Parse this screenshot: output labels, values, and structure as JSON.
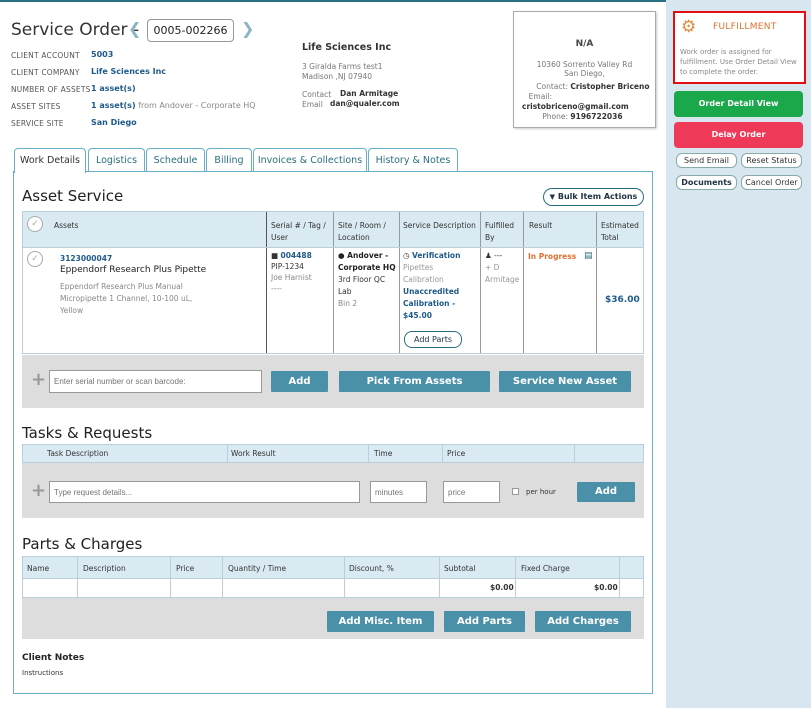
{
  "header": {
    "title": "Service Order -",
    "order_number": "0005-002266",
    "fields": [
      {
        "label": "CLIENT ACCOUNT",
        "value": "5003",
        "extra": ""
      },
      {
        "label": "CLIENT COMPANY",
        "value": "Life Sciences Inc",
        "extra": ""
      },
      {
        "label": "NUMBER OF ASSETS",
        "value": "1 asset(s)",
        "extra": ""
      },
      {
        "label": "ASSET SITES",
        "value": "1 asset(s)",
        "extra": " from Andover - Corporate HQ"
      },
      {
        "label": "SERVICE SITE",
        "value": "San Diego",
        "extra": ""
      }
    ],
    "company": {
      "name": "Life Sciences Inc",
      "address1": "3 Giralda Farms test1",
      "address2": "Madison ,NJ 07940",
      "contact_label": "Contact",
      "contact": "Dan Armitage",
      "email_label": "Email",
      "email": "dan@qualer.com"
    },
    "card": {
      "title": "N/A",
      "address1": "10360 Sorrento Valley Rd",
      "address2": "San Diego,",
      "contact_label": "Contact:",
      "contact": "Cristopher Briceno",
      "email_label": "Email:",
      "email": "cristobriceno@gmail.com",
      "phone_label": "Phone:",
      "phone": "9196722036"
    }
  },
  "sidebar": {
    "fulfillment_title": "FULFILLMENT",
    "fulfillment_text": "Work order is assigned for fulfillment. Use Order Detail View to complete the order.",
    "order_detail_view": "Order Detail View",
    "delay_order": "Delay Order",
    "send_email": "Send Email",
    "reset_status": "Reset Status",
    "documents": "Documents",
    "cancel_order": "Cancel Order"
  },
  "tabs": [
    "Work Details",
    "Logistics",
    "Schedule",
    "Billing",
    "Invoices & Collections",
    "History & Notes"
  ],
  "asset_service": {
    "title": "Asset Service",
    "bulk_actions": "Bulk Item Actions",
    "columns": [
      "Assets",
      "Serial # / Tag / User",
      "Site / Room / Location",
      "Service Description",
      "Fulfilled By",
      "Result",
      "Estimated Total"
    ],
    "row": {
      "asset_id": "3123000047",
      "asset_name": "Eppendorf Research Plus Pipette",
      "asset_desc1": "Eppendorf Research Plus Manual",
      "asset_desc2": "Micropipette 1 Channel, 10-100 uL,",
      "asset_desc3": "Yellow",
      "serial": "004488",
      "tag": "PIP-1234",
      "user": "Joe Harnist",
      "user_extra": "----",
      "site": "Andover -",
      "site2": "Corporate HQ",
      "room": "3rd Floor QC",
      "room2": "Lab",
      "location": "Bin 2",
      "service": "Verification",
      "service_sub1": "Pipettes",
      "service_sub2": "Calibration",
      "service_un1": "Unaccredited",
      "service_un2": "Calibration -",
      "service_price": "$45.00",
      "add_parts": "Add Parts",
      "fulfilled": "---",
      "fulfilled_by1": "+ D",
      "fulfilled_by2": "Armitage",
      "result": "In Progress",
      "total": "$36.00"
    },
    "serial_placeholder": "Enter serial number or scan barcode:",
    "add": "Add",
    "pick_from_assets": "Pick From Assets",
    "service_new_asset": "Service New Asset"
  },
  "tasks": {
    "title": "Tasks & Requests",
    "columns": [
      "Task Description",
      "Work Result",
      "Time",
      "Price"
    ],
    "request_placeholder": "Type request details...",
    "minutes_placeholder": "minutes",
    "price_placeholder": "price",
    "per_hour": "per hour",
    "add": "Add"
  },
  "parts": {
    "title": "Parts & Charges",
    "columns": [
      "Name",
      "Description",
      "Price",
      "Quantity / Time",
      "Discount, %",
      "Subtotal",
      "Fixed Charge"
    ],
    "subtotal": "$0.00",
    "fixed_charge": "$0.00",
    "add_misc": "Add Misc. Item",
    "add_parts": "Add Parts",
    "add_charges": "Add Charges"
  },
  "client_notes": {
    "title": "Client Notes",
    "text": "Instructions"
  },
  "colors": {
    "accent": "#2a6f7f",
    "button": "#4a90a8",
    "green": "#1aa84a",
    "red": "#ee3a58",
    "highlight": "#e01010"
  }
}
